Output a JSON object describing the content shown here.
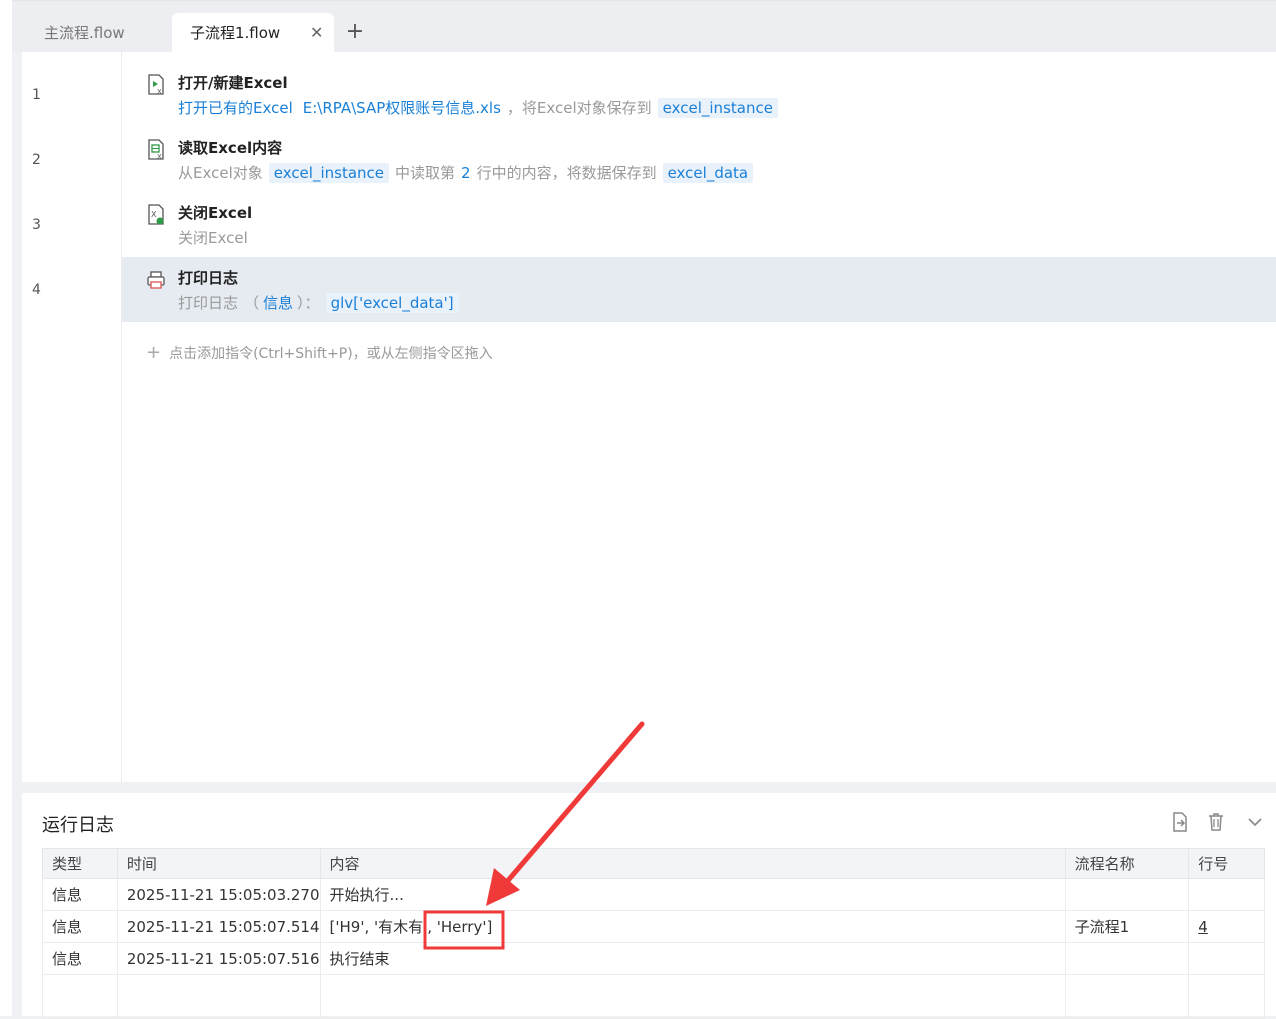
{
  "tabs": [
    {
      "label": "主流程.flow"
    },
    {
      "label": "子流程1.flow",
      "close": "✕"
    }
  ],
  "tab_add": "+",
  "steps": [
    {
      "line": "1",
      "title": "打开/新建Excel",
      "desc": {
        "a": "打开已有的Excel",
        "b": "E:\\RPA\\SAP权限账号信息.xls",
        "c": "，",
        "d": "将Excel对象保存到",
        "e": "excel_instance"
      }
    },
    {
      "line": "2",
      "title": "读取Excel内容",
      "desc": {
        "a": "从Excel对象",
        "b": "excel_instance",
        "c": "中读取第",
        "d": "2",
        "e": "行中的内容，将数据保存到",
        "f": "excel_data"
      }
    },
    {
      "line": "3",
      "title": "关闭Excel",
      "desc": {
        "a": "关闭Excel"
      }
    },
    {
      "line": "4",
      "title": "打印日志",
      "desc": {
        "a": "打印日志",
        "b": "（",
        "c": "信息",
        "d": "）：",
        "e": "glv['excel_data']"
      }
    }
  ],
  "add_command": {
    "plus": "+",
    "text": "点击添加指令(Ctrl+Shift+P)，或从左侧指令区拖入"
  },
  "log": {
    "title": "运行日志",
    "columns": [
      "类型",
      "时间",
      "内容",
      "流程名称",
      "行号"
    ],
    "rows": [
      {
        "type": "信息",
        "time": "2025-11-21 15:05:03.270",
        "content": "开始执行...",
        "flow": "",
        "line": ""
      },
      {
        "type": "信息",
        "time": "2025-11-21 15:05:07.514",
        "content": "['H9', '有木有', 'Herry']",
        "flow": "子流程1",
        "line": "4"
      },
      {
        "type": "信息",
        "time": "2025-11-21 15:05:07.516",
        "content": "执行结束",
        "flow": "",
        "line": ""
      }
    ]
  },
  "colors": {
    "accent": "#1a7fd6",
    "selected_row": "#e6ebf2",
    "annotation": "#f03a3a"
  }
}
